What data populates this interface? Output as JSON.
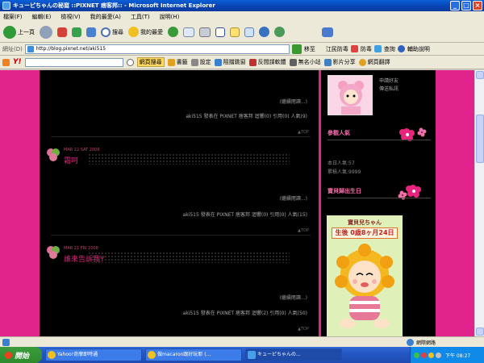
{
  "window": {
    "title": "キューピちゃんの秘窩 ::PIXNET 痞客邦:: - Microsoft Internet Explorer",
    "min": "_",
    "max": "□",
    "close": "×"
  },
  "menu": [
    "檔案(F)",
    "編輯(E)",
    "檢視(V)",
    "我的最愛(A)",
    "工具(T)",
    "說明(H)"
  ],
  "toolbar": {
    "back": "上一頁",
    "search": "搜尋",
    "favorites": "我的最愛",
    "right_label": "江民防毒",
    "fanghu": "防毒",
    "chaxun": "查詢",
    "help": "輔助說明"
  },
  "address": {
    "label": "網址(D)",
    "url": "http://blog.pixnet.net/aki515",
    "go": "移至"
  },
  "linkbar": {
    "logo": "Y!",
    "search_btn": "網頁搜尋",
    "bookmarks": "書籤",
    "settings": "設定",
    "blocker": "阻擋跳窗",
    "antispy": "反間諜軟體",
    "sites": "無名小站",
    "video": "影片分享",
    "translate": "網頁翻譯"
  },
  "posts": [
    {
      "more": "(繼續閱讀...)",
      "meta": "aki515 發表在 PIXNET 痞客邦 迴響(0) 引用(0) 人氣(9)",
      "top": "▲TOP"
    },
    {
      "date": "MAR 22 SAT 2008",
      "title": "霜呵",
      "more": "(繼續閱讀...)",
      "meta": "aki515 發表在 PIXNET 痞客邦 迴響(0) 引用(0) 人氣(15)",
      "top": "▲TOP"
    },
    {
      "date": "MAR 21 FRI 2008",
      "title": "誰來告訴我Y",
      "more": "(繼續閱讀...)",
      "meta": "aki515 發表在 PIXNET 痞客邦 迴響(2) 引用(0) 人氣(50)",
      "top": "▲TOP"
    }
  ],
  "sidebar": {
    "add_friend": "申請好友",
    "send_msg": "傳送私訊",
    "popularity_title": "參觀人氣",
    "today": "本日人氣:57",
    "total": "累積人氣:9999",
    "birthday_title": "寶貝歸出生日",
    "baby_title": "寶貝兒ちゃん",
    "baby_age": "生後 0歳8ヶ月24日"
  },
  "status": {
    "zone": "網際網路"
  },
  "taskbar": {
    "start": "開始",
    "tasks": [
      "Yahoo!奇摩即時通",
      "做macaron跟好玩耶 (...",
      "キューピちゃんの..."
    ],
    "clock": "下午 08:27"
  },
  "colors": {
    "page_bg": "#e0248c",
    "accent": "#f06aa8"
  }
}
